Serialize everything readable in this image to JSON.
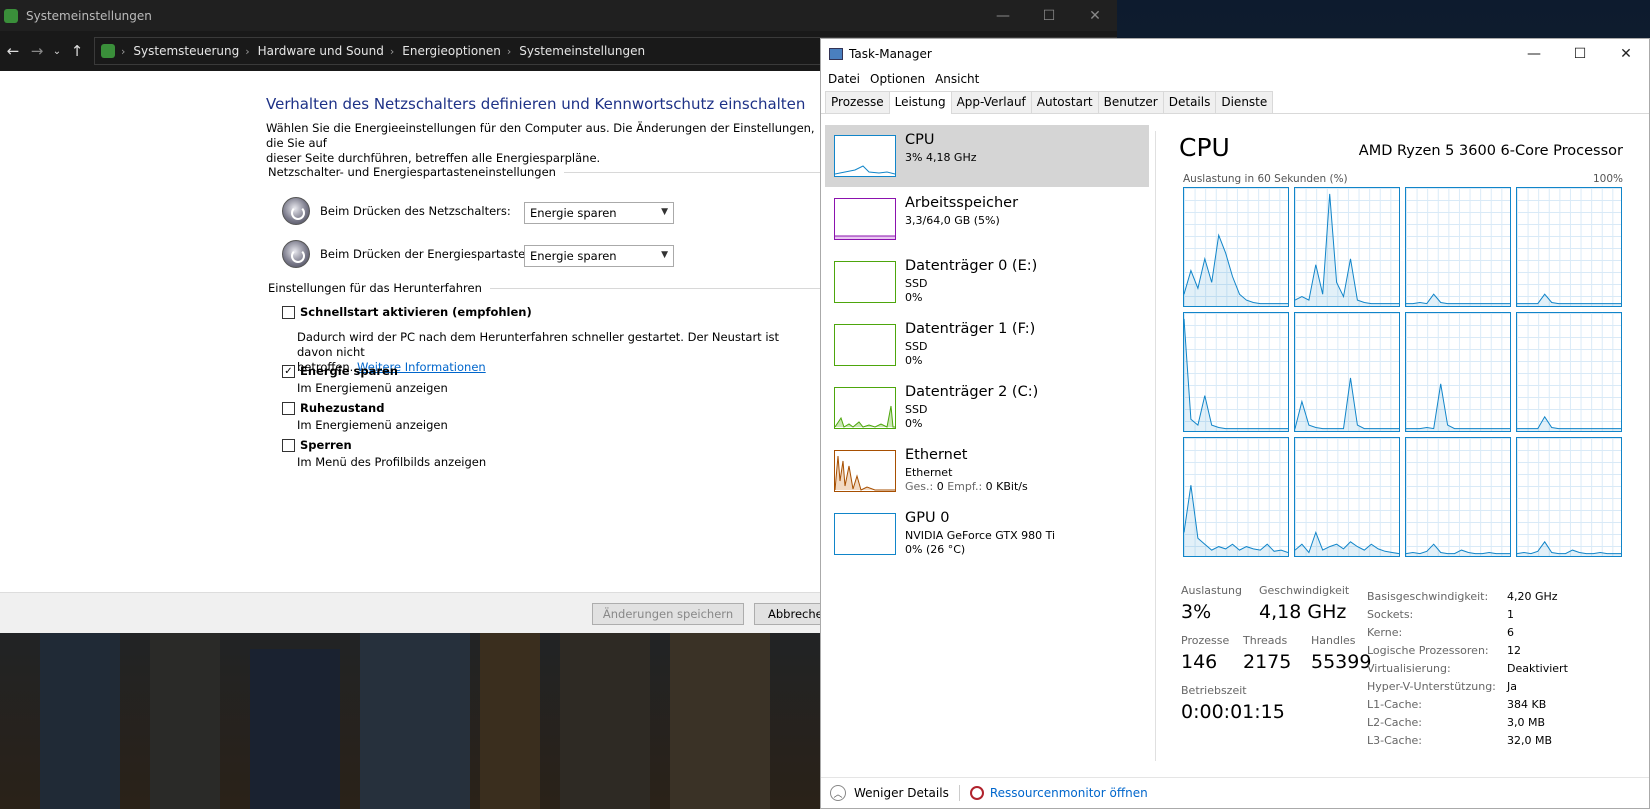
{
  "cp": {
    "window_title": "Systemeinstellungen",
    "breadcrumb": [
      "Systemsteuerung",
      "Hardware und Sound",
      "Energieoptionen",
      "Systemeinstellungen"
    ],
    "heading": "Verhalten des Netzschalters definieren und Kennwortschutz einschalten",
    "intro_line1": "Wählen Sie die Energieeinstellungen für den Computer aus. Die Änderungen der Einstellungen, die Sie auf",
    "intro_line2": "dieser Seite durchführen, betreffen alle Energiesparpläne.",
    "group1": "Netzschalter- und Energiespartasteneinstellungen",
    "power_button_label": "Beim Drücken des Netzschalters:",
    "power_button_value": "Energie sparen",
    "sleep_button_label": "Beim Drücken der Energiespartaste:",
    "sleep_button_value": "Energie sparen",
    "group2": "Einstellungen für das Herunterfahren",
    "fast_startup": {
      "label": "Schnellstart aktivieren (empfohlen)",
      "checked": false,
      "desc1": "Dadurch wird der PC nach dem Herunterfahren schneller gestartet. Der Neustart ist davon nicht",
      "desc2": "betroffen.",
      "link": "Weitere Informationen"
    },
    "sleep": {
      "label": "Energie sparen",
      "checked": true,
      "desc": "Im Energiemenü anzeigen"
    },
    "hibernate": {
      "label": "Ruhezustand",
      "checked": false,
      "desc": "Im Energiemenü anzeigen"
    },
    "lock": {
      "label": "Sperren",
      "checked": false,
      "desc": "Im Menü des Profilbilds anzeigen"
    },
    "save_button": "Änderungen speichern",
    "cancel_button": "Abbrechen"
  },
  "tm": {
    "window_title": "Task-Manager",
    "menu": [
      "Datei",
      "Optionen",
      "Ansicht"
    ],
    "tabs": [
      "Prozesse",
      "Leistung",
      "App-Verlauf",
      "Autostart",
      "Benutzer",
      "Details",
      "Dienste"
    ],
    "active_tab": "Leistung",
    "resources": [
      {
        "name": "CPU",
        "sub1": "3%  4,18 GHz",
        "sub2": "",
        "color": "#1185c9"
      },
      {
        "name": "Arbeitsspeicher",
        "sub1": "3,3/64,0 GB (5%)",
        "sub2": "",
        "color": "#8b12ae"
      },
      {
        "name": "Datenträger 0 (E:)",
        "sub1": "SSD",
        "sub2": "0%",
        "color": "#4da60c"
      },
      {
        "name": "Datenträger 1 (F:)",
        "sub1": "SSD",
        "sub2": "0%",
        "color": "#4da60c"
      },
      {
        "name": "Datenträger 2 (C:)",
        "sub1": "SSD",
        "sub2": "0%",
        "color": "#4da60c"
      },
      {
        "name": "Ethernet",
        "sub1": "Ethernet",
        "sub2_label_send": "Ges.:",
        "sub2_send": "0",
        "sub2_label_recv": "Empf.:",
        "sub2_recv": "0 KBit/s",
        "color": "#a74f01"
      },
      {
        "name": "GPU 0",
        "sub1": "NVIDIA GeForce GTX 980 Ti",
        "sub2": "0%  (26 °C)",
        "color": "#1185c9"
      }
    ],
    "cpu_heading": "CPU",
    "cpu_model": "AMD Ryzen 5 3600 6-Core Processor",
    "graph_label": "Auslastung in 60 Sekunden (%)",
    "graph_max": "100%",
    "stats": {
      "util_label": "Auslastung",
      "util": "3%",
      "speed_label": "Geschwindigkeit",
      "speed": "4,18 GHz",
      "proc_label": "Prozesse",
      "proc": "146",
      "threads_label": "Threads",
      "threads": "2175",
      "handles_label": "Handles",
      "handles": "55399",
      "uptime_label": "Betriebszeit",
      "uptime": "0:00:01:15"
    },
    "specs": [
      [
        "Basisgeschwindigkeit:",
        "4,20 GHz"
      ],
      [
        "Sockets:",
        "1"
      ],
      [
        "Kerne:",
        "6"
      ],
      [
        "Logische Prozessoren:",
        "12"
      ],
      [
        "Virtualisierung:",
        "Deaktiviert"
      ],
      [
        "Hyper-V-Unterstützung:",
        "Ja"
      ],
      [
        "L1-Cache:",
        "384 KB"
      ],
      [
        "L2-Cache:",
        "3,0 MB"
      ],
      [
        "L3-Cache:",
        "32,0 MB"
      ]
    ],
    "fewer_details": "Weniger Details",
    "resource_monitor": "Ressourcenmonitor öffnen"
  },
  "chart_data": {
    "type": "line",
    "title": "Auslastung in 60 Sekunden (%)",
    "ylim": [
      0,
      100
    ],
    "series": [
      {
        "values": [
          10,
          30,
          15,
          40,
          20,
          60,
          45,
          25,
          10,
          5,
          3,
          2,
          2,
          2,
          2,
          2
        ]
      },
      {
        "values": [
          5,
          8,
          5,
          35,
          10,
          95,
          20,
          8,
          40,
          5,
          3,
          2,
          2,
          2,
          2,
          2
        ]
      },
      {
        "values": [
          2,
          2,
          3,
          2,
          10,
          3,
          2,
          2,
          2,
          2,
          2,
          2,
          2,
          2,
          2,
          2
        ]
      },
      {
        "values": [
          2,
          2,
          2,
          2,
          10,
          3,
          2,
          2,
          2,
          2,
          2,
          2,
          2,
          2,
          2,
          2
        ]
      },
      {
        "values": [
          95,
          10,
          5,
          30,
          5,
          3,
          2,
          2,
          2,
          2,
          2,
          2,
          2,
          2,
          2,
          2
        ]
      },
      {
        "values": [
          2,
          25,
          5,
          3,
          2,
          2,
          2,
          2,
          45,
          5,
          2,
          2,
          2,
          2,
          2,
          2
        ]
      },
      {
        "values": [
          2,
          2,
          2,
          3,
          2,
          40,
          5,
          2,
          2,
          2,
          2,
          2,
          2,
          2,
          2,
          2
        ]
      },
      {
        "values": [
          2,
          2,
          2,
          2,
          12,
          3,
          2,
          2,
          2,
          2,
          2,
          2,
          2,
          2,
          2,
          2
        ]
      },
      {
        "values": [
          20,
          60,
          15,
          10,
          5,
          8,
          6,
          10,
          5,
          8,
          6,
          5,
          10,
          4,
          5,
          3
        ]
      },
      {
        "values": [
          5,
          10,
          3,
          20,
          5,
          8,
          10,
          6,
          12,
          8,
          5,
          10,
          6,
          4,
          3,
          2
        ]
      },
      {
        "values": [
          2,
          3,
          2,
          4,
          10,
          3,
          2,
          2,
          5,
          3,
          2,
          2,
          3,
          2,
          2,
          2
        ]
      },
      {
        "values": [
          2,
          3,
          2,
          4,
          12,
          3,
          2,
          2,
          5,
          3,
          2,
          2,
          3,
          2,
          2,
          2
        ]
      }
    ]
  }
}
